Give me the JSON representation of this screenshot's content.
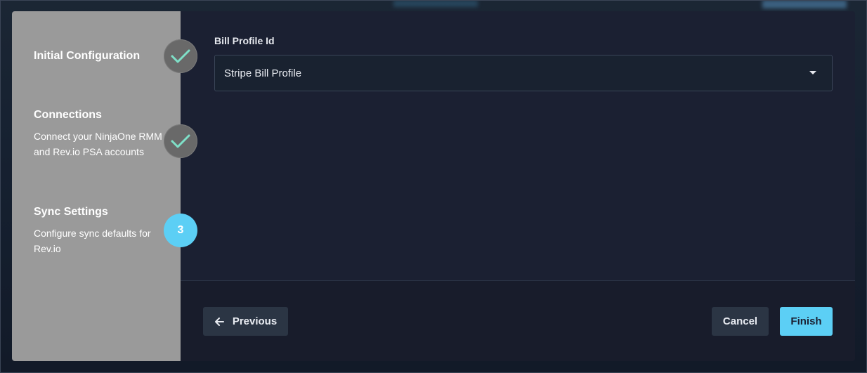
{
  "steps": [
    {
      "title": "Initial Configuration",
      "description": "",
      "state": "complete",
      "marker_icon": "check-icon"
    },
    {
      "title": "Connections",
      "description": "Connect your NinjaOne RMM and Rev.io PSA accounts",
      "state": "complete",
      "marker_icon": "check-icon"
    },
    {
      "title": "Sync Settings",
      "description": "Configure sync defaults for Rev.io",
      "state": "active",
      "number": "3"
    }
  ],
  "form": {
    "bill_profile_label": "Bill Profile Id",
    "bill_profile_value": "Stripe Bill Profile"
  },
  "footer": {
    "previous_label": "Previous",
    "cancel_label": "Cancel",
    "finish_label": "Finish"
  },
  "colors": {
    "accent": "#5ccff5",
    "check": "#7fe0c8",
    "stepper_bg": "#9a9a9a",
    "modal_bg": "#1b2032"
  }
}
